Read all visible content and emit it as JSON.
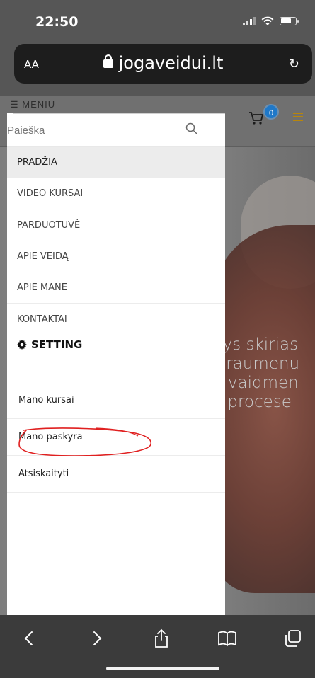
{
  "status_bar": {
    "time": "22:50"
  },
  "url_bar": {
    "aa_label": "AA",
    "domain": "jogaveidui.lt"
  },
  "site": {
    "menu_hint": "☰ MENIU",
    "cart_count": "0",
    "hero_lines": [
      "nys skirias",
      "s raumenu",
      "ų vaidmen",
      "o procese"
    ]
  },
  "drawer": {
    "search": {
      "placeholder": "Paieška"
    },
    "nav": [
      {
        "label": "PRADŽIA"
      },
      {
        "label": "VIDEO KURSAI"
      },
      {
        "label": "PARDUOTUVĖ"
      },
      {
        "label": "APIE VEIDĄ"
      },
      {
        "label": "APIE MANE"
      },
      {
        "label": "KONTAKTAI"
      }
    ],
    "settings_heading": "SETTING",
    "account": [
      {
        "label": "Mano kursai"
      },
      {
        "label": "Mano paskyra"
      },
      {
        "label": "Atsiskaityti"
      }
    ]
  },
  "annotation": {
    "color": "#e02020"
  },
  "icons": {
    "search": "search-icon",
    "gear": "gear-icon",
    "back": "chevron-left-icon",
    "forward": "chevron-right-icon",
    "share": "share-icon",
    "bookmarks": "book-icon",
    "tabs": "tabs-icon"
  }
}
